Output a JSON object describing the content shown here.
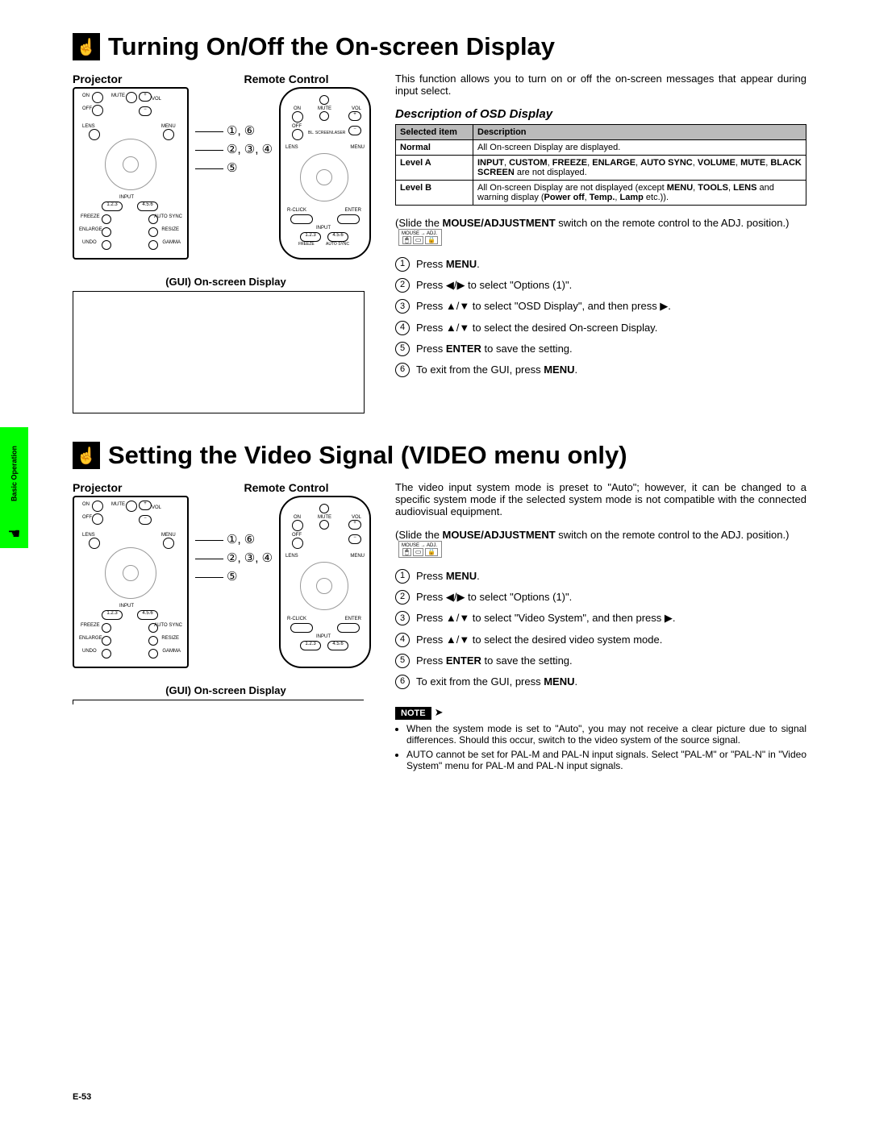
{
  "sidebar": {
    "label": "Basic Operation"
  },
  "section1": {
    "title": "Turning On/Off the On-screen Display",
    "projector_label": "Projector",
    "remote_label": "Remote Control",
    "callout1": "①, ⑥",
    "callout2": "②, ③, ④",
    "callout3": "⑤",
    "gui_label": "(GUI) On-screen Display",
    "intro": "This function allows you to turn on or off the on-screen messages that appear during input select.",
    "desc_title": "Description of OSD Display",
    "table": {
      "h1": "Selected item",
      "h2": "Description",
      "r1c1": "Normal",
      "r1c2": "All On-screen Display are displayed.",
      "r2c1": "Level A",
      "r2c2a": "INPUT",
      "r2c2b": ", ",
      "r2c2c": "CUSTOM",
      "r2c2d": ", ",
      "r2c2e": "FREEZE",
      "r2c2f": ", ",
      "r2c2g": "ENLARGE",
      "r2c2h": ", ",
      "r2c2i": "AUTO SYNC",
      "r2c2j": ", ",
      "r2c2k": "VOLUME",
      "r2c2l": ", ",
      "r2c2m": "MUTE",
      "r2c2n": ", ",
      "r2c2o": "BLACK SCREEN",
      "r2c2p": " are not displayed.",
      "r3c1": "Level B",
      "r3c2a": "All On-screen Display are not displayed (except ",
      "r3c2b": "MENU",
      "r3c2c": ", ",
      "r3c2d": "TOOLS",
      "r3c2e": ", ",
      "r3c2f": "LENS",
      "r3c2g": " and warning display (",
      "r3c2h": "Power off",
      "r3c2i": ", ",
      "r3c2j": "Temp.",
      "r3c2k": ", ",
      "r3c2l": "Lamp",
      "r3c2m": " etc.))."
    },
    "slide_note_a": "(Slide the ",
    "slide_note_b": "MOUSE/ADJUSTMENT",
    "slide_note_c": " switch on the remote control to the ADJ. position.)",
    "mouse_label": "MOUSE",
    "adj_label": "ADJ.",
    "steps": {
      "s1a": "Press ",
      "s1b": "MENU",
      "s1c": ".",
      "s2": "Press ◀/▶ to select \"Options (1)\".",
      "s3": "Press ▲/▼ to select \"OSD Display\", and then press ▶.",
      "s4": "Press ▲/▼ to select the desired On-screen Display.",
      "s5a": "Press ",
      "s5b": "ENTER",
      "s5c": " to save the setting.",
      "s6a": "To exit from the GUI, press ",
      "s6b": "MENU",
      "s6c": "."
    }
  },
  "section2": {
    "title": "Setting the Video Signal (VIDEO menu only)",
    "projector_label": "Projector",
    "remote_label": "Remote Control",
    "callout1": "①, ⑥",
    "callout2": "②, ③, ④",
    "callout3": "⑤",
    "gui_label": "(GUI) On-screen Display",
    "intro": "The video input system mode is preset to \"Auto\"; however, it can be changed to a specific system mode if the selected system mode is not compatible with the connected audiovisual equipment.",
    "slide_note_a": "(Slide the ",
    "slide_note_b": "MOUSE/ADJUSTMENT",
    "slide_note_c": " switch on the remote control to the ADJ. position.)",
    "steps": {
      "s1a": "Press ",
      "s1b": "MENU",
      "s1c": ".",
      "s2": "Press ◀/▶ to select \"Options (1)\".",
      "s3": "Press ▲/▼ to select \"Video System\", and then press ▶.",
      "s4": "Press ▲/▼ to select the desired video system mode.",
      "s5a": "Press ",
      "s5b": "ENTER",
      "s5c": " to save the setting.",
      "s6a": "To exit from the GUI, press ",
      "s6b": "MENU",
      "s6c": "."
    },
    "note_label": "NOTE",
    "notes": {
      "n1": "When the system mode is set to \"Auto\", you may not receive a clear picture due to signal differences. Should this occur, switch to the video system of the source signal.",
      "n2": "AUTO cannot be set for PAL-M and PAL-N input signals. Select \"PAL-M\" or \"PAL-N\" in \"Video System\" menu for PAL-M and PAL-N input signals."
    }
  },
  "diagram_labels": {
    "on": "ON",
    "off": "OFF",
    "mute": "MUTE",
    "vol": "VOL",
    "lens": "LENS",
    "menu": "MENU",
    "input": "INPUT",
    "freeze": "FREEZE",
    "autosync": "AUTO SYNC",
    "enlarge": "ENLARGE",
    "resize": "RESIZE",
    "undo": "UNDO",
    "gamma": "GAMMA",
    "rclick": "R-CLICK",
    "enter": "ENTER",
    "bl_screen": "BL. SCREEN",
    "laser": "LASER",
    "n123": "1.2.3",
    "n456": "4.5.6"
  },
  "page_number": "E-53"
}
